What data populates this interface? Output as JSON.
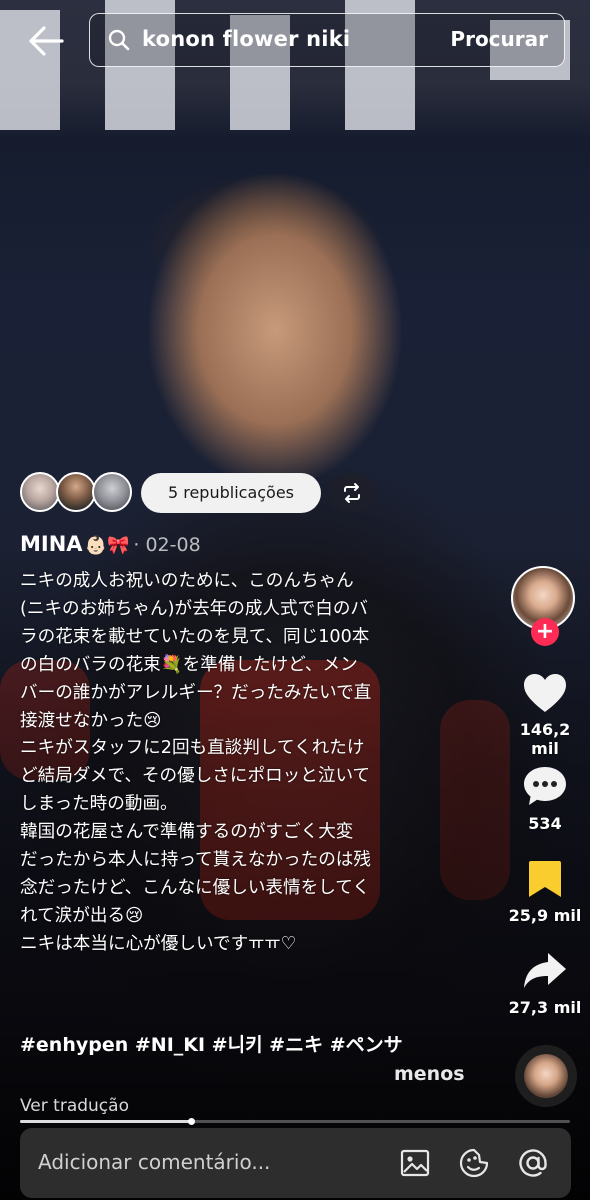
{
  "search": {
    "query": "konon flower niki",
    "submit_label": "Procurar"
  },
  "reposts": {
    "label": "5 republicações"
  },
  "post": {
    "author": "MINA",
    "author_emoji": "👶🏻🎀",
    "date": "· 02-08",
    "caption_lines": [
      "ニキの成人お祝いのために、このんちゃん",
      "(ニキのお姉ちゃん)が去年の成人式で白のバ",
      "ラの花束を載せていたのを見て、同じ100本",
      "の白のバラの花束💐を準備したけど、メン",
      "バーの誰かがアレルギー？だったみたいで直",
      "接渡せなかった😢",
      "ニキがスタッフに2回も直談判してくれたけ",
      "ど結局ダメで、その優しさにポロッと泣いて",
      "しまった時の動画。",
      "韓国の花屋さんで準備するのがすごく大変",
      "だったから本人に持って貰えなかったのは残",
      "念だったけど、こんなに優しい表情をしてく",
      "れて涙が出る😢",
      "ニキは本当に心が優しいですㅠㅠ♡"
    ],
    "hashtags": "#enhypen #NI_KI #니키 #ニキ #ペンサ",
    "less_label": "menos",
    "translate_label": "Ver tradução",
    "progress": 0.31
  },
  "rail": {
    "likes": "146,2 mil",
    "comments": "534",
    "saves": "25,9 mil",
    "shares": "27,3 mil",
    "follow_symbol": "+"
  },
  "comment_bar": {
    "placeholder": "Adicionar comentário..."
  },
  "colors": {
    "accent_red": "#fe2c55",
    "save_yellow": "#facd2e",
    "comment_bar_bg": "#2d2d2d"
  }
}
